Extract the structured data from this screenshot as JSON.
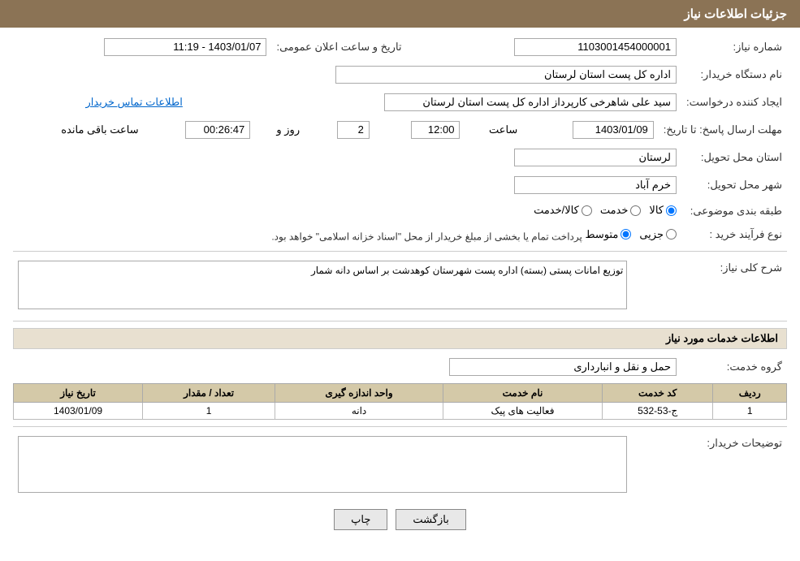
{
  "header": {
    "title": "جزئیات اطلاعات نیاز"
  },
  "fields": {
    "shomara_niaz_label": "شماره نیاز:",
    "shomara_niaz_value": "1103001454000001",
    "nam_dastgah_label": "نام دستگاه خریدار:",
    "nam_dastgah_value": "اداره کل پست استان لرستان",
    "tarikh_elam_label": "تاریخ و ساعت اعلان عمومی:",
    "tarikh_elam_value": "1403/01/07 - 11:19",
    "ijad_label": "ایجاد کننده درخواست:",
    "ijad_value": "سید علی شاهرخی کارپرداز اداره کل پست استان لرستان",
    "ettelaat_tamas": "اطلاعات تماس خریدار",
    "mohlat_label": "مهلت ارسال پاسخ: تا تاریخ:",
    "mohlat_date": "1403/01/09",
    "mohlat_saat": "12:00",
    "mohlat_roz": "2",
    "mohlat_baqi": "00:26:47",
    "ostan_label": "استان محل تحویل:",
    "ostan_value": "لرستان",
    "shahr_label": "شهر محل تحویل:",
    "shahr_value": "خرم آباد",
    "tabaqe_label": "طبقه بندی موضوعی:",
    "tabaqe_options": [
      "کالا",
      "خدمت",
      "کالا/خدمت"
    ],
    "tabaqe_selected": "کالا",
    "nooe_farayand_label": "نوع فرآیند خرید :",
    "nooe_farayand_options": [
      "جزیی",
      "متوسط"
    ],
    "nooe_farayand_note": "پرداخت تمام یا بخشی از مبلغ خریدار از محل \"اسناد خزانه اسلامی\" خواهد بود.",
    "sharh_label": "شرح کلی نیاز:",
    "sharh_value": "توزیع امانات پستی (بسته) اداره پست شهرستان کوهدشت بر اساس دانه شمار",
    "khadamat_label": "اطلاعات خدمات مورد نیاز",
    "goroh_label": "گروه خدمت:",
    "goroh_value": "حمل و نقل و انبارداری",
    "table_headers": [
      "ردیف",
      "کد خدمت",
      "نام خدمت",
      "واحد اندازه گیری",
      "تعداد / مقدار",
      "تاریخ نیاز"
    ],
    "table_rows": [
      {
        "radif": "1",
        "kod": "ج-53-532",
        "nam": "فعالیت های پیک",
        "vahed": "دانه",
        "tedad": "1",
        "tarikh": "1403/01/09"
      }
    ],
    "tozihat_label": "توضیحات خریدار:",
    "tozihat_value": "",
    "btn_chap": "چاپ",
    "btn_bazgasht": "بازگشت",
    "saat_baqi_label": "ساعت باقی مانده",
    "roz_label": "روز و"
  }
}
